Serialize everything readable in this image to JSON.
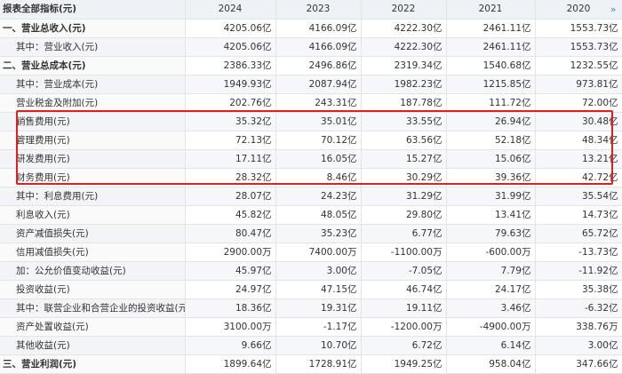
{
  "header": {
    "title": "报表全部指标(元)",
    "years": [
      "2024",
      "2023",
      "2022",
      "2021",
      "2020"
    ],
    "more_icon": "double-chevron-right-icon"
  },
  "rows": [
    {
      "label": "一、营业总收入(元)",
      "values": [
        "4205.06亿",
        "4166.09亿",
        "4222.30亿",
        "2461.11亿",
        "1553.73亿"
      ]
    },
    {
      "label": "其中：营业收入(元)",
      "values": [
        "4205.06亿",
        "4166.09亿",
        "4222.30亿",
        "2461.11亿",
        "1553.73亿"
      ]
    },
    {
      "label": "二、营业总成本(元)",
      "values": [
        "2386.33亿",
        "2496.86亿",
        "2319.34亿",
        "1540.68亿",
        "1232.55亿"
      ]
    },
    {
      "label": "其中：营业成本(元)",
      "values": [
        "1949.93亿",
        "2087.94亿",
        "1982.23亿",
        "1215.85亿",
        "973.81亿"
      ]
    },
    {
      "label": "营业税金及附加(元)",
      "values": [
        "202.76亿",
        "243.31亿",
        "187.78亿",
        "111.72亿",
        "72.00亿"
      ]
    },
    {
      "label": "销售费用(元)",
      "values": [
        "35.32亿",
        "35.01亿",
        "33.55亿",
        "26.94亿",
        "30.48亿"
      ]
    },
    {
      "label": "管理费用(元)",
      "values": [
        "72.13亿",
        "70.12亿",
        "63.56亿",
        "52.18亿",
        "48.34亿"
      ]
    },
    {
      "label": "研发费用(元)",
      "values": [
        "17.11亿",
        "16.05亿",
        "15.27亿",
        "15.06亿",
        "13.21亿"
      ]
    },
    {
      "label": "财务费用(元)",
      "values": [
        "28.32亿",
        "8.46亿",
        "30.29亿",
        "39.36亿",
        "42.72亿"
      ]
    },
    {
      "label": "其中：利息费用(元)",
      "values": [
        "28.07亿",
        "24.23亿",
        "31.29亿",
        "31.99亿",
        "35.54亿"
      ]
    },
    {
      "label": "利息收入(元)",
      "values": [
        "45.82亿",
        "48.05亿",
        "29.80亿",
        "13.41亿",
        "14.73亿"
      ]
    },
    {
      "label": "资产减值损失(元)",
      "values": [
        "80.47亿",
        "35.23亿",
        "6.77亿",
        "79.63亿",
        "65.72亿"
      ]
    },
    {
      "label": "信用减值损失(元)",
      "values": [
        "2900.00万",
        "7400.00万",
        "-1100.00万",
        "-600.00万",
        "-13.73亿"
      ]
    },
    {
      "label": "加：公允价值变动收益(元)",
      "values": [
        "45.97亿",
        "3.00亿",
        "-7.05亿",
        "7.79亿",
        "-11.92亿"
      ]
    },
    {
      "label": "投资收益(元)",
      "values": [
        "24.97亿",
        "47.15亿",
        "46.74亿",
        "24.17亿",
        "35.38亿"
      ]
    },
    {
      "label": "其中：联营企业和合营企业的投资收益(元)",
      "values": [
        "18.36亿",
        "19.31亿",
        "19.11亿",
        "3.46亿",
        "-6.32亿"
      ]
    },
    {
      "label": "资产处置收益(元)",
      "values": [
        "3100.00万",
        "-1.17亿",
        "-1200.00万",
        "-4900.00万",
        "338.76万"
      ]
    },
    {
      "label": "其他收益(元)",
      "values": [
        "9.66亿",
        "10.70亿",
        "6.72亿",
        "6.14亿",
        "3.00亿"
      ]
    },
    {
      "label": "三、营业利润(元)",
      "values": [
        "1899.64亿",
        "1728.91亿",
        "1949.25亿",
        "958.04亿",
        "347.66亿"
      ]
    }
  ],
  "highlight": {
    "color": "#e02020",
    "rows": [
      "销售费用(元)",
      "管理费用(元)",
      "研发费用(元)",
      "财务费用(元)"
    ]
  }
}
